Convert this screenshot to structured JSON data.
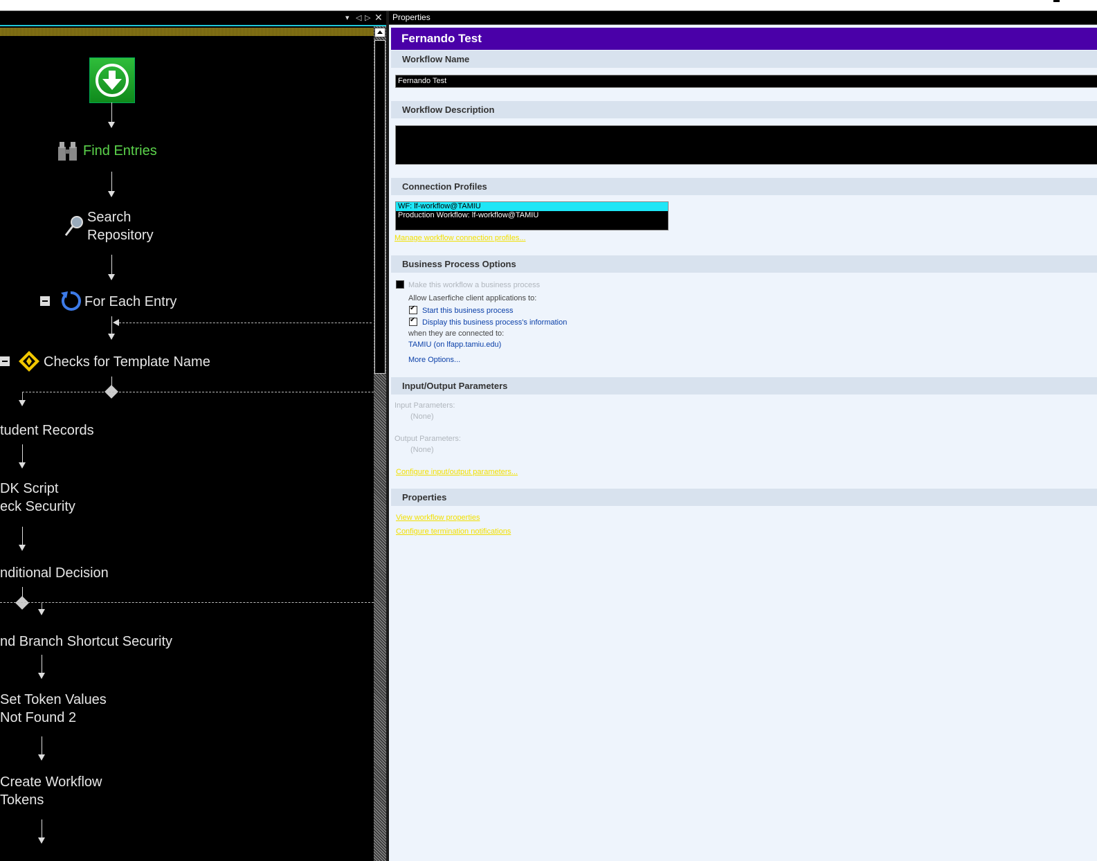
{
  "designer": {
    "nodes": {
      "find_entries": "Find Entries",
      "search_repo_1": "Search",
      "search_repo_2": "Repository",
      "for_each": "For Each Entry",
      "checks_template": "Checks for Template Name",
      "student_records": "tudent Records",
      "sdk_script_1": "DK Script",
      "sdk_script_2": "eck Security",
      "cond_decision": "nditional Decision",
      "find_branch": "nd Branch Shortcut Security",
      "set_token_1": "Set Token Values",
      "set_token_2": "Not Found 2",
      "create_tokens_1": "Create Workflow",
      "create_tokens_2": "Tokens"
    }
  },
  "properties": {
    "panel_title": "Properties",
    "header_title": "Fernando Test",
    "workflow_name": {
      "label": "Workflow Name",
      "value": "Fernando Test"
    },
    "workflow_description": {
      "label": "Workflow Description",
      "value": ""
    },
    "connection_profiles": {
      "label": "Connection Profiles",
      "items": [
        "WF: lf-workflow@TAMIU",
        "Production Workflow: lf-workflow@TAMIU"
      ],
      "manage_link": "Manage workflow connection profiles..."
    },
    "business_process": {
      "label": "Business Process Options",
      "make_bp": "Make this workflow a business process",
      "allow_text": "Allow Laserfiche client applications to:",
      "start_bp": "Start this business process",
      "display_bp": "Display this business process's information",
      "connected_text": "when they are connected to:",
      "repository": "TAMIU (on lfapp.tamiu.edu)",
      "more_options": "More Options..."
    },
    "io_params": {
      "label": "Input/Output Parameters",
      "input_label": "Input Parameters:",
      "input_value": "(None)",
      "output_label": "Output Parameters:",
      "output_value": "(None)",
      "configure_link": "Configure input/output parameters..."
    },
    "props_section": {
      "label": "Properties",
      "view_link": "View workflow properties",
      "termination_link": "Configure termination notifications"
    }
  }
}
